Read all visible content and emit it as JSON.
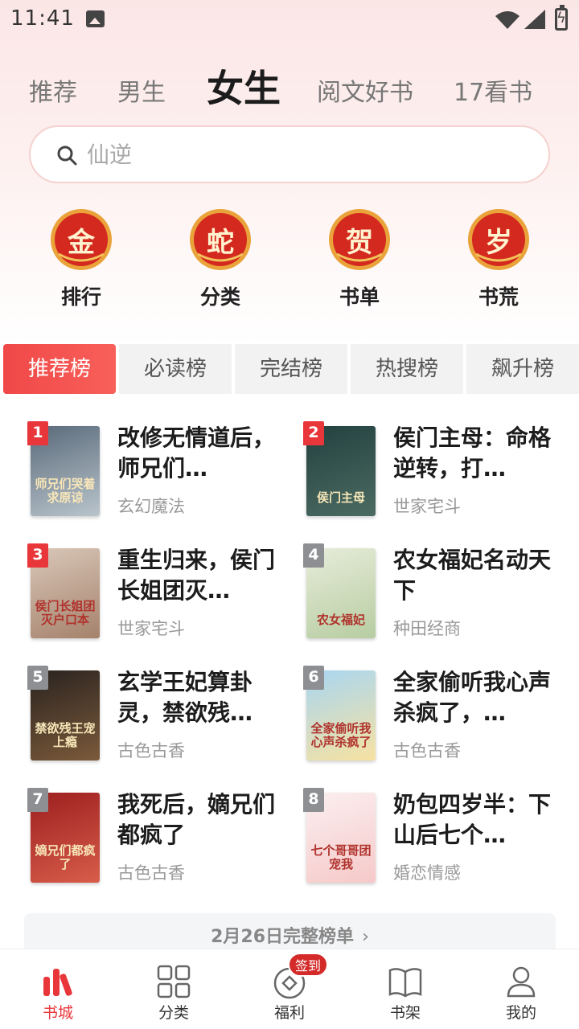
{
  "status_bar": {
    "time": "11:41"
  },
  "top_tabs": [
    {
      "label": "推荐",
      "active": false
    },
    {
      "label": "男生",
      "active": false
    },
    {
      "label": "女生",
      "active": true
    },
    {
      "label": "阅文好书",
      "active": false
    },
    {
      "label": "17看书",
      "active": false
    }
  ],
  "search": {
    "placeholder": "仙逆"
  },
  "quick_entries": [
    {
      "char": "金",
      "label": "排行",
      "icon": "gold-seal-icon"
    },
    {
      "char": "蛇",
      "label": "分类",
      "icon": "snake-seal-icon"
    },
    {
      "char": "贺",
      "label": "书单",
      "icon": "celebrate-seal-icon"
    },
    {
      "char": "岁",
      "label": "书荒",
      "icon": "year-seal-icon"
    }
  ],
  "rank_tabs": [
    {
      "label": "推荐榜",
      "active": true
    },
    {
      "label": "必读榜",
      "active": false
    },
    {
      "label": "完结榜",
      "active": false
    },
    {
      "label": "热搜榜",
      "active": false
    },
    {
      "label": "飙升榜",
      "active": false
    }
  ],
  "books": [
    {
      "rank": "1",
      "title": "改修无情道后，师兄们…",
      "genre": "玄幻魔法",
      "cover_text": "师兄们哭着求原谅",
      "cover_colors": [
        "#5a6a7a",
        "#b9c4cc"
      ]
    },
    {
      "rank": "2",
      "title": "侯门主母：命格逆转，打…",
      "genre": "世家宅斗",
      "cover_text": "侯门主母",
      "cover_colors": [
        "#23413f",
        "#4b6b62"
      ]
    },
    {
      "rank": "3",
      "title": "重生归来，侯门长姐团灭…",
      "genre": "世家宅斗",
      "cover_text": "侯门长姐团灭户口本",
      "cover_colors": [
        "#d9c7b8",
        "#a5826c"
      ]
    },
    {
      "rank": "4",
      "title": "农女福妃名动天下",
      "genre": "种田经商",
      "cover_text": "农女福妃",
      "cover_colors": [
        "#e7ecd9",
        "#b7cda2"
      ]
    },
    {
      "rank": "5",
      "title": "玄学王妃算卦灵，禁欲残…",
      "genre": "古色古香",
      "cover_text": "禁欲残王宠上瘾",
      "cover_colors": [
        "#2a2320",
        "#7b5a3a"
      ]
    },
    {
      "rank": "6",
      "title": "全家偷听我心声杀疯了，…",
      "genre": "古色古香",
      "cover_text": "全家偷听我心声杀疯了",
      "cover_colors": [
        "#a8d6f2",
        "#f7e2a1"
      ]
    },
    {
      "rank": "7",
      "title": "我死后，嫡兄们都疯了",
      "genre": "古色古香",
      "cover_text": "嫡兄们都疯了",
      "cover_colors": [
        "#9d1f1f",
        "#d85d4a"
      ]
    },
    {
      "rank": "8",
      "title": "奶包四岁半：下山后七个…",
      "genre": "婚恋情感",
      "cover_text": "七个哥哥团宠我",
      "cover_colors": [
        "#fbeff0",
        "#f6c9c9"
      ]
    }
  ],
  "full_list": {
    "label": "2月26日完整榜单",
    "chevron": "›"
  },
  "bottom_nav": [
    {
      "label": "书城",
      "icon": "bookstore-icon",
      "active": true
    },
    {
      "label": "分类",
      "icon": "category-grid-icon",
      "active": false
    },
    {
      "label": "福利",
      "icon": "welfare-icon",
      "active": false,
      "badge": "签到"
    },
    {
      "label": "书架",
      "icon": "bookshelf-icon",
      "active": false
    },
    {
      "label": "我的",
      "icon": "profile-icon",
      "active": false
    }
  ],
  "colors": {
    "accent": "#e8363a",
    "active_tab_gradient_start": "#f04848",
    "badge_gray": "#8d8f93"
  }
}
